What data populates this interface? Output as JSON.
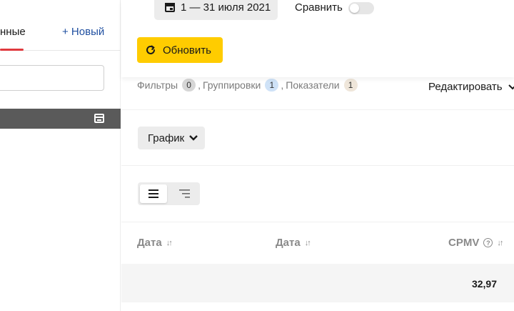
{
  "sidebar": {
    "tab_saved": "нные",
    "new_link": "+ Новый",
    "search_placeholder": ""
  },
  "header": {
    "date_range": "1 — 31 июля 2021",
    "compare_label": "Сравнить",
    "compare_enabled": false,
    "refresh_label": "Обновить"
  },
  "filters": {
    "filters_label": "Фильтры",
    "filters_count": "0",
    "sep1": ",",
    "groupings_label": "Группировки",
    "groupings_count": "1",
    "sep2": ",",
    "metrics_label": "Показатели",
    "metrics_count": "1",
    "edit_label": "Редактировать"
  },
  "view": {
    "chart_label": "График",
    "mode_selected": "table"
  },
  "table": {
    "columns": [
      {
        "label": "Дата",
        "sort": "↓↑"
      },
      {
        "label": "Дата",
        "sort": "↓↑"
      },
      {
        "label": "CPMV",
        "sort": "↓↑",
        "help": "?"
      }
    ],
    "total_value": "32,97"
  },
  "colors": {
    "accent_yellow": "#ffcc00",
    "active_tab_red": "#e0393e",
    "link_blue": "#1f4fa0"
  },
  "icons": [
    "calendar-icon",
    "refresh-icon",
    "chevron-down-icon",
    "list-view-icon",
    "tree-view-icon",
    "sort-icon",
    "help-icon",
    "layout-icon"
  ]
}
